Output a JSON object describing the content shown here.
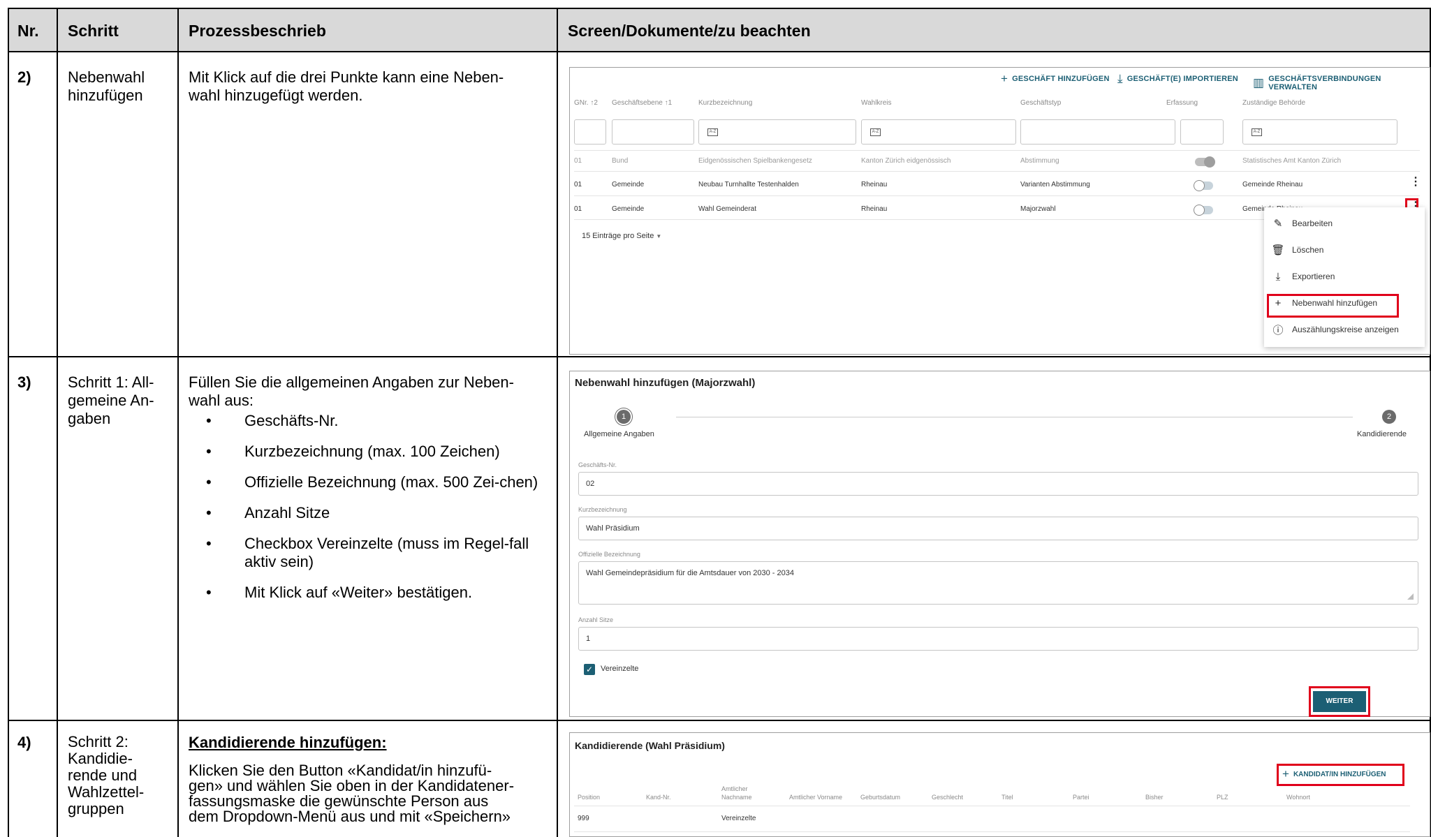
{
  "header": {
    "nr": "Nr.",
    "schritt": "Schritt",
    "prozess": "Prozessbeschrieb",
    "screen": "Screen/Dokumente/zu beachten"
  },
  "rows": [
    {
      "nr": "2)",
      "schritt": [
        "Nebenwahl",
        "hinzufügen"
      ],
      "prozess": [
        "Mit Klick auf die drei Punkte kann eine Neben-",
        "wahl hinzugefügt werden."
      ]
    },
    {
      "nr": "3)",
      "schritt": [
        "Schritt 1: All-",
        "gemeine An-",
        "gaben"
      ],
      "prozess_intro": [
        "Füllen Sie die allgemeinen Angaben zur Neben-",
        "wahl aus:"
      ],
      "bullets": [
        "Geschäfts-Nr.",
        "Kurzbezeichnung (max. 100 Zeichen)",
        "Offizielle Bezeichnung (max. 500 Zei-chen)",
        "Anzahl Sitze",
        "Checkbox Vereinzelte (muss im Regel-fall aktiv sein)",
        "Mit Klick auf «Weiter» bestätigen."
      ]
    },
    {
      "nr": "4)",
      "schritt": [
        "Schritt 2:",
        "Kandidie-",
        "rende und",
        "Wahlzettel-",
        "gruppen"
      ],
      "prozess_heading": "Kandidierende hinzufügen:",
      "prozess": [
        "Klicken Sie den Button «Kandidat/in hinzufü-",
        "gen» und wählen Sie oben in der Kandidatener-",
        "fassungsmaske die gewünschte Person aus",
        "dem Dropdown-Menü aus und mit «Speichern»"
      ]
    }
  ],
  "screen1": {
    "toolbar": [
      {
        "icon": "plus-icon",
        "label": "GESCHÄFT HINZUFÜGEN"
      },
      {
        "icon": "download-icon",
        "label": "GESCHÄFT(E) IMPORTIEREN"
      },
      {
        "icon": "building-icon",
        "label": "GESCHÄFTSVERBINDUNGEN VERWALTEN"
      }
    ],
    "columns": [
      "GNr. ↑2",
      "Geschäftsebene ↑1",
      "Kurzbezeichnung",
      "Wahlkreis",
      "Geschäftstyp",
      "Erfassung",
      "Zuständige Behörde"
    ],
    "filter_icon_text": "A-Z",
    "table_rows": [
      {
        "gnr": "01",
        "ebene": "Bund",
        "kurz": "Eidgenössischen Spielbankengesetz",
        "wahlkreis": "Kanton Zürich eidgenössisch",
        "typ": "Abstimmung",
        "erfassung": true,
        "behoerde": "Statistisches Amt Kanton Zürich",
        "muted": true
      },
      {
        "gnr": "01",
        "ebene": "Gemeinde",
        "kurz": "Neubau Turnhallte Testenhalden",
        "wahlkreis": "Rheinau",
        "typ": "Varianten Abstimmung",
        "erfassung": false,
        "behoerde": "Gemeinde Rheinau",
        "muted": false
      },
      {
        "gnr": "01",
        "ebene": "Gemeinde",
        "kurz": "Wahl Gemeinderat",
        "wahlkreis": "Rheinau",
        "typ": "Majorzwahl",
        "erfassung": false,
        "behoerde": "Gemeinde Rheinau",
        "muted": false
      }
    ],
    "per_page": "15 Einträge pro Seite",
    "menu": [
      {
        "icon": "pencil-icon",
        "label": "Bearbeiten"
      },
      {
        "icon": "trash-icon",
        "label": "Löschen"
      },
      {
        "icon": "download-icon",
        "label": "Exportieren"
      },
      {
        "icon": "plus-icon",
        "label": "Nebenwahl hinzufügen"
      },
      {
        "icon": "info-icon",
        "label": "Auszählungskreise anzeigen"
      }
    ]
  },
  "screen2": {
    "title": "Nebenwahl hinzufügen (Majorzwahl)",
    "step1_num": "1",
    "step1_label": "Allgemeine Angaben",
    "step2_num": "2",
    "step2_label": "Kandidierende",
    "fields": [
      {
        "label": "Geschäfts-Nr.",
        "value": "02"
      },
      {
        "label": "Kurzbezeichnung",
        "value": "Wahl Präsidium"
      },
      {
        "label": "Offizielle Bezeichnung",
        "value": "Wahl Gemeindepräsidium für die Amtsdauer von 2030 - 2034"
      },
      {
        "label": "Anzahl Sitze",
        "value": "1"
      }
    ],
    "checkbox_label": "Vereinzelte",
    "weiter": "WEITER"
  },
  "screen3": {
    "title": "Kandidierende (Wahl Präsidium)",
    "add_button": "KANDIDAT/IN HINZUFÜGEN",
    "columns": [
      "Position",
      "Kand-Nr.",
      "Amtlicher Nachname",
      "Amtlicher Vorname",
      "Geburtsdatum",
      "Geschlecht",
      "Titel",
      "Partei",
      "Bisher",
      "PLZ",
      "Wohnort"
    ],
    "row": {
      "position": "999",
      "nachname": "Vereinzelte"
    }
  },
  "colors": {
    "accent": "#1c5f74",
    "highlight": "#e0001b",
    "header_bg": "#d9d9d9"
  }
}
